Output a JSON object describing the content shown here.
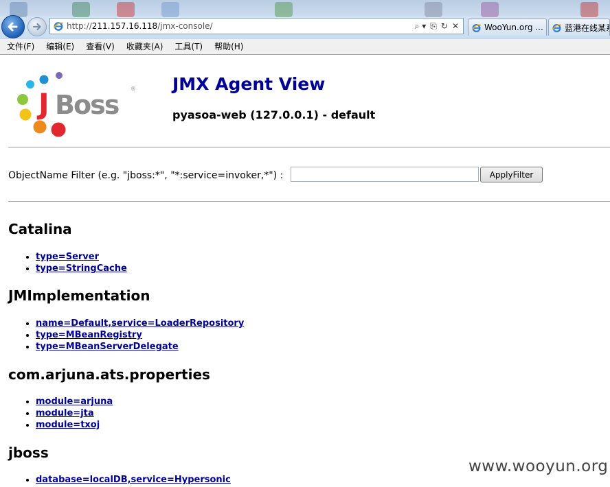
{
  "browser": {
    "address": {
      "url_scheme": "http://",
      "url_host": "211.157.16.118",
      "url_path": "/jmx-console/",
      "controls": [
        "⌕ ▾",
        "⎘",
        "↻",
        "✕"
      ]
    },
    "tabs": [
      {
        "label": "WooYun.org ..."
      },
      {
        "label": "蓝港在线某系"
      }
    ],
    "menu": [
      "文件(F)",
      "编辑(E)",
      "查看(V)",
      "收藏夹(A)",
      "工具(T)",
      "帮助(H)"
    ]
  },
  "page": {
    "title": "JMX Agent View",
    "subtitle": "pyasoa-web (127.0.0.1) - default",
    "filter": {
      "label": "ObjectName Filter (e.g. \"jboss:*\", \"*:service=invoker,*\") :",
      "value": "",
      "button_label": "ApplyFilter"
    },
    "domains": [
      {
        "name": "Catalina",
        "mbeans": [
          "type=Server",
          "type=StringCache"
        ]
      },
      {
        "name": "JMImplementation",
        "mbeans": [
          "name=Default,service=LoaderRepository",
          "type=MBeanRegistry",
          "type=MBeanServerDelegate"
        ]
      },
      {
        "name": "com.arjuna.ats.properties",
        "mbeans": [
          "module=arjuna",
          "module=jta",
          "module=txoj"
        ]
      },
      {
        "name": "jboss",
        "mbeans": [
          "database=localDB,service=Hypersonic"
        ]
      }
    ]
  },
  "watermark": "www.wooyun.org",
  "colors": {
    "link": "#000099",
    "title": "#000099",
    "logo_red": "#e2282f",
    "logo_grey": "#8c8c8c"
  }
}
